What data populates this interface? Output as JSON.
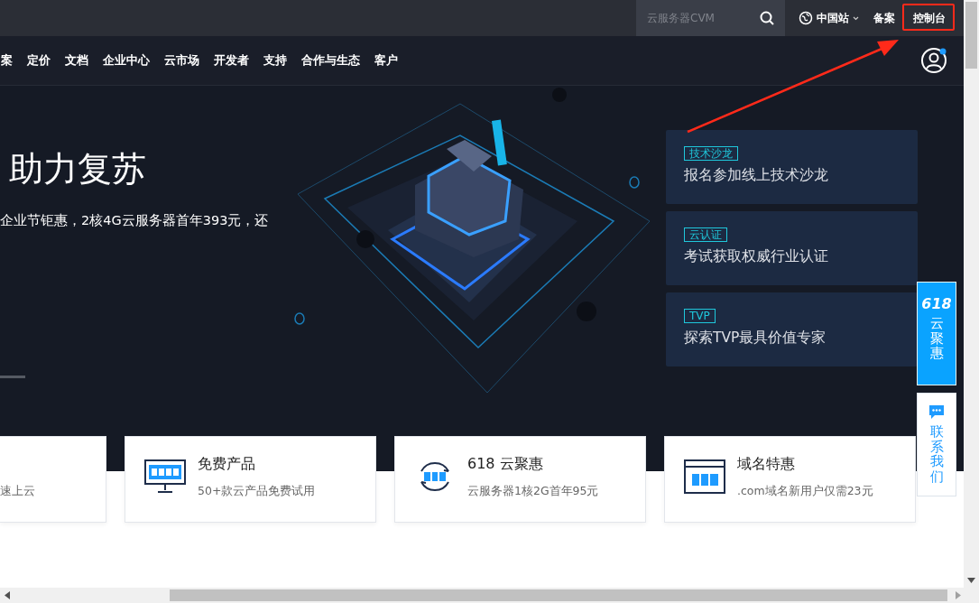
{
  "top_bar": {
    "search": {
      "placeholder": "云服务器CVM"
    },
    "region": "中国站",
    "links": [
      "备案",
      "控制台"
    ]
  },
  "nav": {
    "items": [
      "案",
      "定价",
      "文档",
      "企业中心",
      "云市场",
      "开发者",
      "支持",
      "合作与生态",
      "客户"
    ],
    "user_notification": true
  },
  "hero": {
    "title": "助力复苏",
    "subtitle": "企业节钜惠，2核4G云服务器首年393元，还",
    "promos": [
      {
        "tag": "技术沙龙",
        "text": "报名参加线上技术沙龙"
      },
      {
        "tag": "云认证",
        "text": "考试获取权威行业认证"
      },
      {
        "tag": "TVP",
        "text": "探索TVP最具价值专家"
      }
    ]
  },
  "cards": [
    {
      "kind": "partial",
      "subtitle": "速上云"
    },
    {
      "kind": "free",
      "title": "免费产品",
      "subtitle": "50+款云产品免费试用"
    },
    {
      "kind": "sale",
      "title": "618 云聚惠",
      "subtitle": "云服务器1核2G首年95元"
    },
    {
      "kind": "domain",
      "title": "域名特惠",
      "subtitle": ".com域名新用户仅需23元"
    }
  ],
  "side": {
    "promo_number": "618",
    "promo_text": "云聚惠",
    "contact": "联系我们"
  },
  "annotation": {
    "kind": "highlight"
  }
}
